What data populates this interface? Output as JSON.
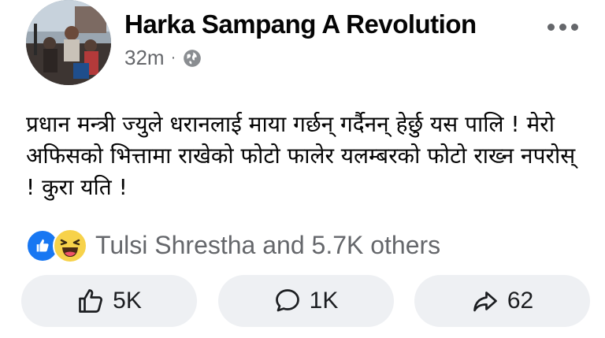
{
  "post": {
    "author": "Harka Sampang A Revolution",
    "time": "32m",
    "separator": "·",
    "privacy_icon": "globe-icon",
    "text": "प्रधान मन्त्री ज्युले धरानलाई माया गर्छन् गर्दैनन् हेर्छु यस पालि ! मेरो अफिसको भित्तामा राखेको फोटो फालेर यलम्बरको फोटो राख्न नपरोस् ! कुरा यति !"
  },
  "reactions": {
    "icons": [
      "like-reaction-icon",
      "haha-reaction-icon"
    ],
    "summary": "Tulsi Shrestha and 5.7K others"
  },
  "actions": {
    "like_count": "5K",
    "comment_count": "1K",
    "share_count": "62"
  },
  "colors": {
    "secondary_text": "#65676b",
    "like_blue": "#1877f2",
    "button_bg": "#eef0f3"
  }
}
